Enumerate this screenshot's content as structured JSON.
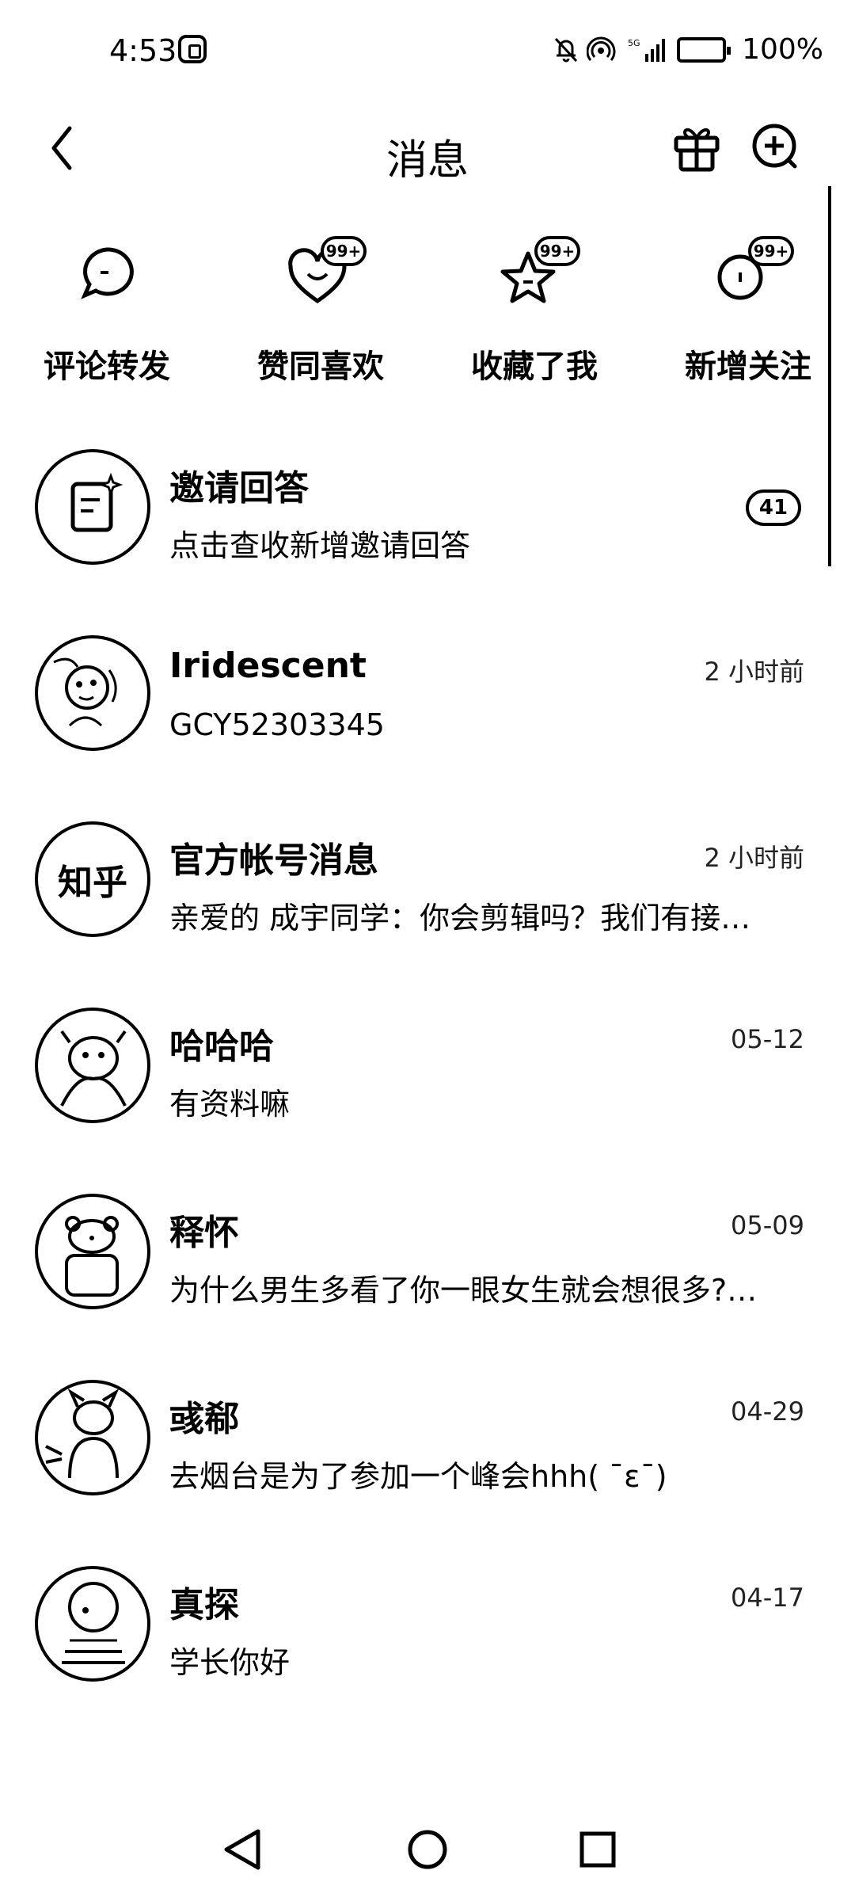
{
  "status_bar": {
    "time": "4:53",
    "battery": "100%"
  },
  "header": {
    "title": "消息"
  },
  "categories": [
    {
      "label": "评论转发",
      "badge": "",
      "icon": "comment-icon"
    },
    {
      "label": "赞同喜欢",
      "badge": "99+",
      "icon": "heart-icon"
    },
    {
      "label": "收藏了我",
      "badge": "99+",
      "icon": "star-icon"
    },
    {
      "label": "新增关注",
      "badge": "99+",
      "icon": "follow-icon"
    }
  ],
  "invite": {
    "title": "邀请回答",
    "subtitle": "点击查收新增邀请回答",
    "count": "41"
  },
  "messages": [
    {
      "name": "Iridescent",
      "text": "GCY52303345",
      "time": "2 小时前"
    },
    {
      "name": "官方帐号消息",
      "text": "亲爱的 成宇同学：你会剪辑吗？我们有接…",
      "time": "2 小时前",
      "avatar_text": "知乎"
    },
    {
      "name": "哈哈哈",
      "text": "有资料嘛",
      "time": "05-12"
    },
    {
      "name": "释怀",
      "text": "为什么男生多看了你一眼女生就会想很多?…",
      "time": "05-09"
    },
    {
      "name": "彧郗",
      "text": "去烟台是为了参加一个峰会hhh( ˉεˉ)",
      "time": "04-29"
    },
    {
      "name": "真探",
      "text": "学长你好",
      "time": "04-17"
    }
  ]
}
